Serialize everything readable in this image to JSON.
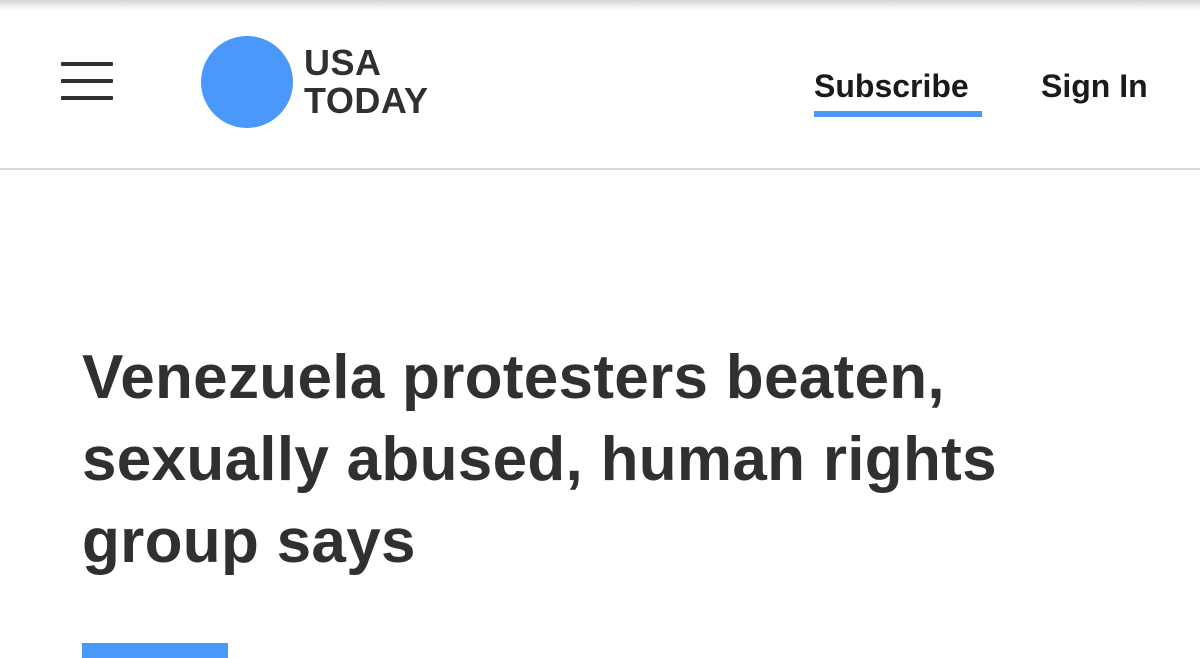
{
  "header": {
    "menu_icon": "hamburger-menu-icon",
    "logo": {
      "line1": "USA",
      "line2": "TODAY",
      "color": "#4a98fa"
    },
    "subscribe_label": "Subscribe",
    "signin_label": "Sign In"
  },
  "article": {
    "headline": "Venezuela protesters beaten, sexually abused, human rights group says"
  },
  "colors": {
    "accent": "#4a98fa",
    "text": "#303030"
  }
}
